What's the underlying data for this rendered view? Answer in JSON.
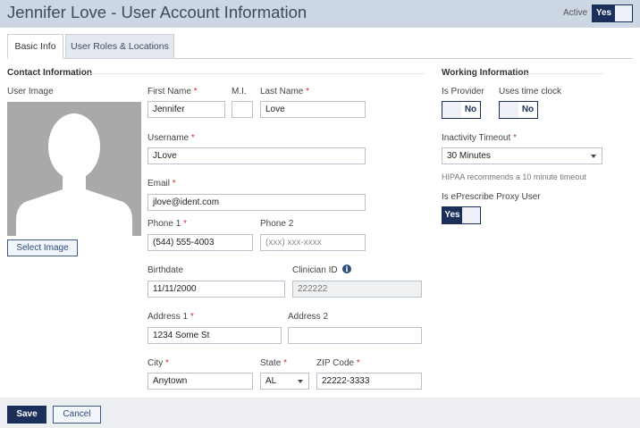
{
  "header": {
    "title": "Jennifer Love - User Account Information",
    "active_label": "Active",
    "active_toggle": "Yes"
  },
  "tabs": [
    {
      "label": "Basic Info",
      "active": true
    },
    {
      "label": "User Roles & Locations",
      "active": false
    }
  ],
  "contact": {
    "section_title": "Contact Information",
    "user_image_label": "User Image",
    "select_image_button": "Select Image",
    "first_name": {
      "label": "First Name",
      "value": "Jennifer"
    },
    "mi": {
      "label": "M.I.",
      "value": ""
    },
    "last_name": {
      "label": "Last Name",
      "value": "Love"
    },
    "username": {
      "label": "Username",
      "value": "JLove"
    },
    "email": {
      "label": "Email",
      "value": "jlove@ident.com"
    },
    "phone1": {
      "label": "Phone 1",
      "value": "(544) 555-4003"
    },
    "phone2": {
      "label": "Phone 2",
      "placeholder": "(xxx) xxx-xxxx"
    },
    "birthdate": {
      "label": "Birthdate",
      "value": "11/11/2000"
    },
    "clinician_id": {
      "label": "Clinician ID",
      "value": "222222"
    },
    "address1": {
      "label": "Address 1",
      "value": "1234 Some St"
    },
    "address2": {
      "label": "Address 2",
      "value": ""
    },
    "city": {
      "label": "City",
      "value": "Anytown"
    },
    "state": {
      "label": "State",
      "value": "AL"
    },
    "zip": {
      "label": "ZIP Code",
      "value": "22222-3333"
    },
    "required_mark": "*"
  },
  "working": {
    "section_title": "Working Information",
    "is_provider": {
      "label": "Is Provider",
      "value": "No"
    },
    "uses_time_clock": {
      "label": "Uses time clock",
      "value": "No"
    },
    "inactivity_timeout": {
      "label": "Inactivity Timeout",
      "value": "30 Minutes",
      "hint": "HIPAA recommends a 10 minute timeout"
    },
    "eprescribe_proxy": {
      "label": "Is ePrescribe Proxy User",
      "value": "Yes"
    }
  },
  "footer": {
    "save_label": "Save",
    "cancel_label": "Cancel"
  },
  "colors": {
    "header_bg": "#cdd6e3",
    "primary": "#1a2f5a",
    "required": "#c0392b"
  }
}
